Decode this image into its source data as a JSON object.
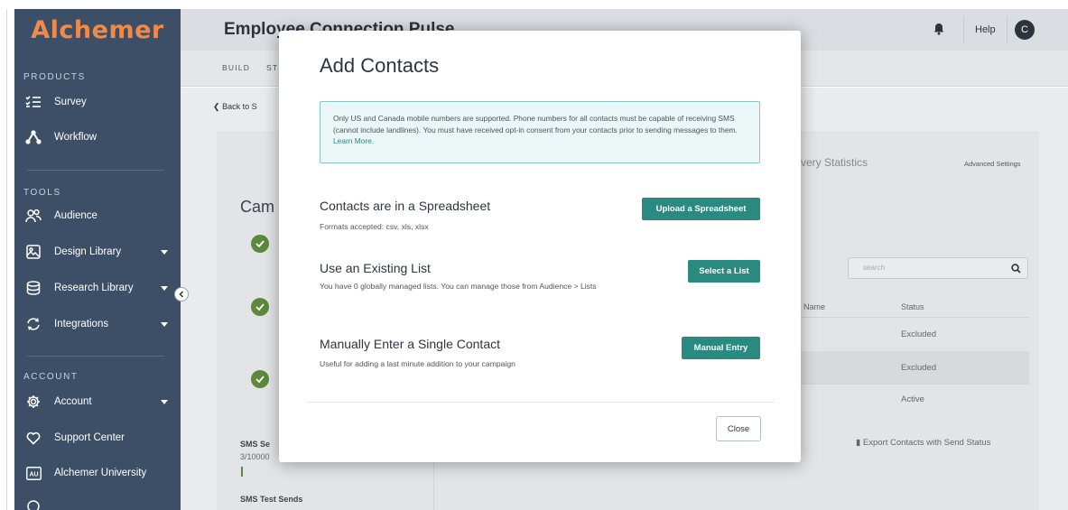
{
  "app": {
    "logo": "Alchemer"
  },
  "sidebar": {
    "sections": [
      {
        "label": "PRODUCTS"
      },
      {
        "label": "TOOLS"
      },
      {
        "label": "ACCOUNT"
      }
    ],
    "items": [
      {
        "label": "Survey",
        "icon": "survey-list-icon"
      },
      {
        "label": "Workflow",
        "icon": "workflow-icon"
      },
      {
        "label": "Audience",
        "icon": "audience-icon"
      },
      {
        "label": "Design Library",
        "icon": "image-icon"
      },
      {
        "label": "Research Library",
        "icon": "database-icon"
      },
      {
        "label": "Integrations",
        "icon": "sync-icon"
      },
      {
        "label": "Account",
        "icon": "gear-icon"
      },
      {
        "label": "Support Center",
        "icon": "heart-icon"
      },
      {
        "label": "Alchemer University",
        "icon": "university-icon"
      },
      {
        "label": "",
        "icon": "partial-icon"
      }
    ]
  },
  "header": {
    "title": "Employee Connection Pulse",
    "help": "Help",
    "avatar": "C"
  },
  "subnav": {
    "items": [
      "BUILD",
      "ST"
    ]
  },
  "background": {
    "back_link": "Back to S",
    "campaign": "Cam",
    "delivery_stats": "very Statistics",
    "advanced_settings": "Advanced Settings",
    "search_placeholder": "search",
    "col_name": "Name",
    "col_status": "Status",
    "statuses": [
      "Excluded",
      "Excluded",
      "Active"
    ],
    "export": "Export Contacts with Send Status",
    "sms_se": "SMS Se",
    "sms_count": "3/10000",
    "sms_test": "SMS Test Sends"
  },
  "modal": {
    "title": "Add Contacts",
    "notice": "Only US and Canada mobile numbers are supported. Phone numbers for all contacts must be capable of receiving SMS (cannot include landlines). You must have received opt-in consent from your contacts prior to sending messages to them.",
    "notice_link": "Learn More.",
    "options": [
      {
        "title": "Contacts are in a Spreadsheet",
        "desc": "Formats accepted: csv, xls, xlsx",
        "button": "Upload a Spreadsheet"
      },
      {
        "title": "Use an Existing List",
        "desc": "You have 0 globally managed lists. You can manage those from Audience > Lists",
        "button": "Select a List"
      },
      {
        "title": "Manually Enter a Single Contact",
        "desc": "Useful for adding a last minute addition to your campaign",
        "button": "Manual Entry"
      }
    ],
    "close": "Close"
  },
  "colors": {
    "sidebar": "#3d4f66",
    "logo": "#f1894a",
    "accent": "#2b8a7f",
    "notice_border": "#88c7c3",
    "notice_bg": "#eaf7f6",
    "check": "#5b8a3a"
  }
}
